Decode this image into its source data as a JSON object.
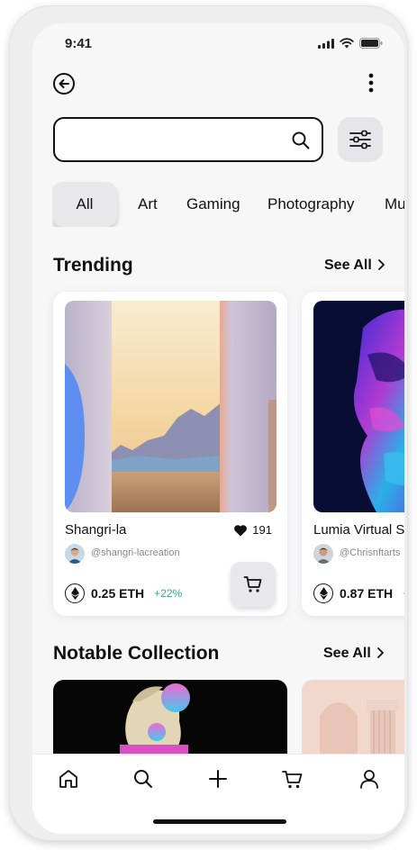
{
  "status_bar": {
    "time": "9:41"
  },
  "search": {
    "value": "",
    "placeholder": ""
  },
  "categories": [
    "All",
    "Art",
    "Gaming",
    "Photography",
    "Mu"
  ],
  "trending": {
    "title": "Trending",
    "see_all": "See All",
    "items": [
      {
        "title": "Shangri-la",
        "likes": "191",
        "creator": "@shangri-lacreation",
        "price": "0.25 ETH",
        "change": "+22%"
      },
      {
        "title": "Lumia Virtual S",
        "likes": "",
        "creator": "@Chrisnftarts",
        "price": "0.87 ETH",
        "change": "+"
      }
    ]
  },
  "notable": {
    "title": "Notable Collection",
    "see_all": "See All"
  },
  "colors": {
    "accent_green": "#3aa38a",
    "ink": "#111111",
    "chip_bg": "#e8e8ea"
  },
  "icons": [
    "back-arrow-icon",
    "more-vertical-icon",
    "search-icon",
    "filter-icon",
    "heart-icon",
    "ethereum-icon",
    "cart-icon",
    "home-icon",
    "plus-icon",
    "user-icon"
  ]
}
